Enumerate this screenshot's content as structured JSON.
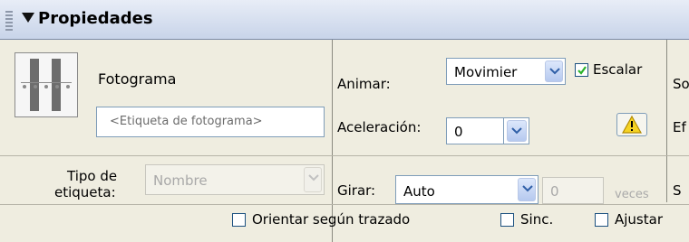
{
  "panel": {
    "title": "Propiedades"
  },
  "frame": {
    "label": "Fotograma",
    "name_placeholder": "<Etiqueta de fotograma>",
    "label_type_label": "Tipo de",
    "label_type_label2": "etiqueta:",
    "label_type_value": "Nombre"
  },
  "tween": {
    "animate_label": "Animar:",
    "animate_value": "Movimier",
    "scale_label": "Escalar",
    "scale_checked": true,
    "ease_label": "Aceleración:",
    "ease_value": "0",
    "rotate_label": "Girar:",
    "rotate_value": "Auto",
    "rotate_times_value": "0",
    "times_label": "veces"
  },
  "options": {
    "orient_label": "Orientar según trazado",
    "sync_label": "Sinc.",
    "snap_label": "Ajustar"
  },
  "right_cut": {
    "r1": "So",
    "r2": "Ef",
    "r3": "S"
  },
  "icons": {
    "warning": "warning-icon",
    "dropdown": "chevron-down-icon",
    "collapse": "collapse-triangle-icon"
  },
  "colors": {
    "accent": "#2f5fa7",
    "panel_bg": "#efede0",
    "header_bg": "#c8d4e9",
    "warning_yellow": "#f5d324"
  }
}
